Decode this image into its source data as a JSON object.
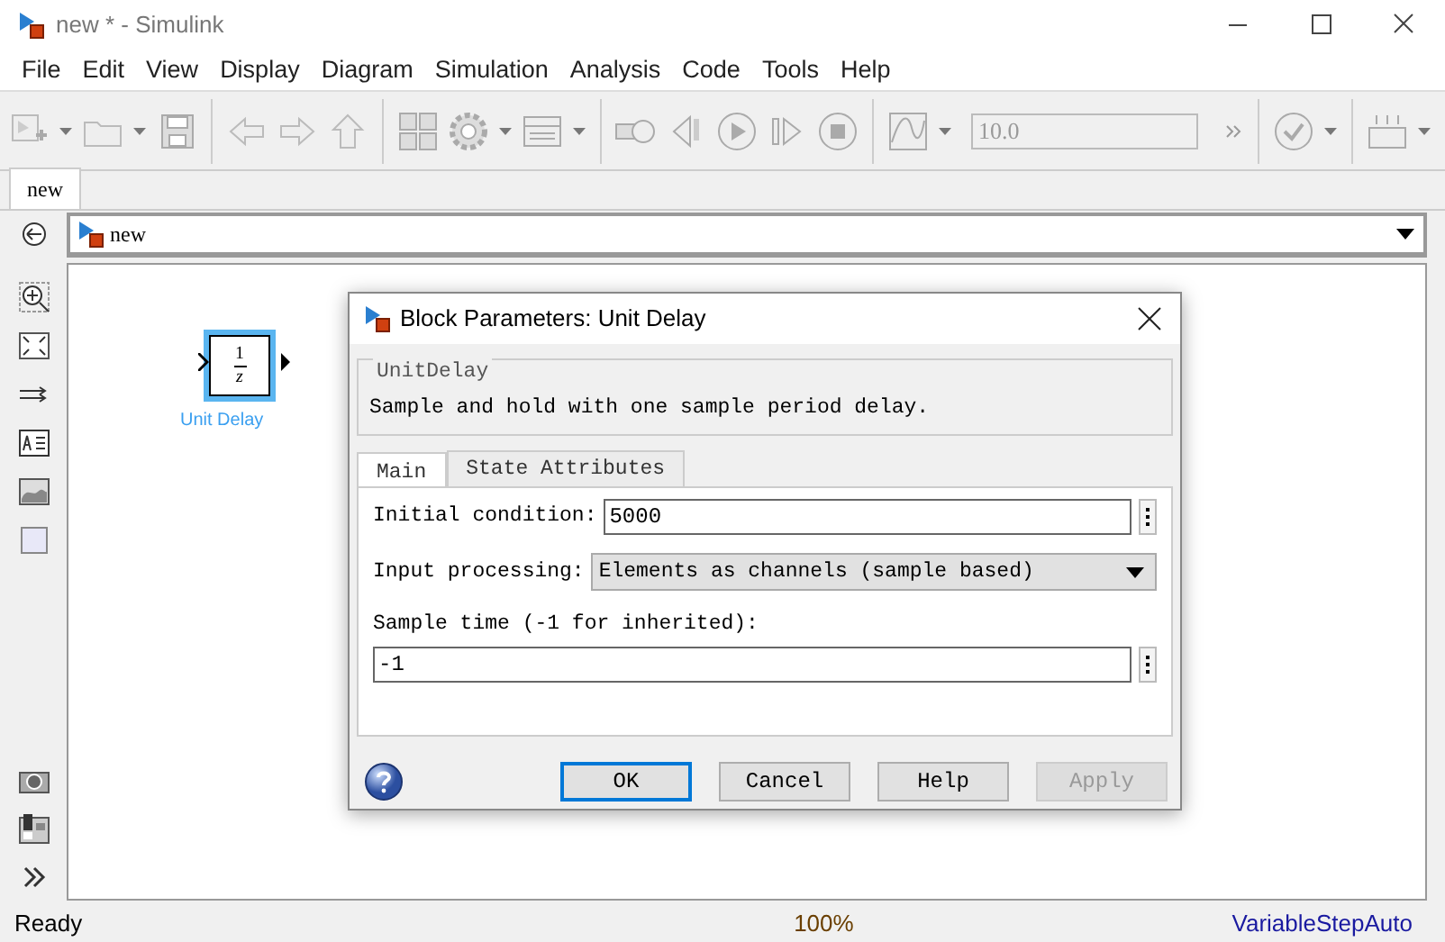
{
  "window": {
    "title": "new * - Simulink"
  },
  "menu": [
    "File",
    "Edit",
    "View",
    "Display",
    "Diagram",
    "Simulation",
    "Analysis",
    "Code",
    "Tools",
    "Help"
  ],
  "toolbar": {
    "stop_time": "10.0"
  },
  "tabs": [
    {
      "label": "new",
      "selected": true
    }
  ],
  "address": {
    "path": "new"
  },
  "block": {
    "numerator": "1",
    "denominator": "z",
    "label": "Unit Delay",
    "selected": true
  },
  "dialog": {
    "title": "Block Parameters: Unit Delay",
    "group_label": "UnitDelay",
    "description": "Sample and hold with one sample period delay.",
    "tabs": [
      {
        "label": "Main",
        "selected": true
      },
      {
        "label": "State Attributes",
        "selected": false
      }
    ],
    "fields": [
      {
        "kind": "inline",
        "label": "Initial condition:",
        "value": "5000"
      },
      {
        "kind": "select",
        "label": "Input processing:",
        "value": "Elements as channels (sample based)"
      },
      {
        "kind": "stacked",
        "label": "Sample time (-1 for inherited):",
        "value": "-1"
      }
    ],
    "buttons": [
      {
        "label": "OK",
        "focused": true,
        "disabled": false
      },
      {
        "label": "Cancel",
        "focused": false,
        "disabled": false
      },
      {
        "label": "Help",
        "focused": false,
        "disabled": false
      },
      {
        "label": "Apply",
        "focused": false,
        "disabled": true
      }
    ]
  },
  "status_bar": {
    "state": "Ready",
    "zoom": "100%",
    "solver": "VariableStepAuto"
  }
}
